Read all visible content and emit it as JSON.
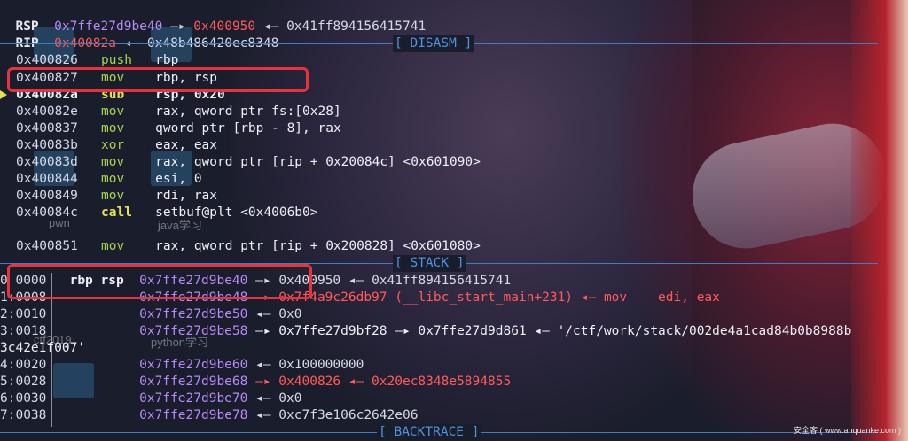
{
  "regs": [
    {
      "name": "RSP",
      "v1": "0x7ffe27d9be40",
      "a1": "—▸",
      "v2": "0x400950",
      "a2": "◂—",
      "v3": "0x41ff894156415741"
    },
    {
      "name": "RIP",
      "v1": "0x40082a",
      "a1": "◂—",
      "v2": "0x48b486420ec8348"
    }
  ],
  "sections": {
    "disasm": "[ DISASM ]",
    "stack": "[ STACK ]",
    "backtrace": "[ BACKTRACE ]"
  },
  "disasm": [
    {
      "addr": "0x400826",
      "op": "push",
      "args": "rbp"
    },
    {
      "addr": "0x400827",
      "op": "mov",
      "args": "rbp, rsp"
    },
    {
      "addr": "0x40082a",
      "op": "sub",
      "args": "rsp, 0x20",
      "current": true
    },
    {
      "addr": "0x40082e",
      "op": "mov",
      "args": "rax, qword ptr fs:[0x28]"
    },
    {
      "addr": "0x400837",
      "op": "mov",
      "args": "qword ptr [rbp - 8], rax"
    },
    {
      "addr": "0x40083b",
      "op": "xor",
      "args": "eax, eax"
    },
    {
      "addr": "0x40083d",
      "op": "mov",
      "args": "rax, qword ptr [rip + 0x20084c] <0x601090>"
    },
    {
      "addr": "0x400844",
      "op": "mov",
      "args": "esi, 0"
    },
    {
      "addr": "0x400849",
      "op": "mov",
      "args": "rdi, rax"
    },
    {
      "addr": "0x40084c",
      "op": "call",
      "args": "setbuf@plt <0x4006b0>"
    },
    {
      "addr": "0x400851",
      "op": "mov",
      "args": "rax, qword ptr [rip + 0x200828] <0x601080>"
    }
  ],
  "stack": [
    {
      "idx": "0",
      "off": "0000",
      "regs": "rbp rsp",
      "addr": "0x7ffe27d9be40",
      "rest": "—▸ 0x400950 ◂— 0x41ff894156415741"
    },
    {
      "idx": "1",
      "off": "0008",
      "regs": "",
      "addr": "0x7ffe27d9be48",
      "rest": "—▸ 0x7f4a9c26db97 (__libc_start_main+231) ◂— mov    edi, eax"
    },
    {
      "idx": "2",
      "off": "0010",
      "regs": "",
      "addr": "0x7ffe27d9be50",
      "rest": "◂— 0x0"
    },
    {
      "idx": "3",
      "off": "0018",
      "regs": "",
      "addr": "0x7ffe27d9be58",
      "rest": "—▸ 0x7ffe27d9bf28 —▸ 0x7ffe27d9d861 ◂— '/ctf/work/stack/002de4a1cad84b0b8988b"
    },
    {
      "idx": "",
      "off": "",
      "regs": "",
      "addr": "",
      "rest": "3c42e1f007'",
      "cont": true
    },
    {
      "idx": "4",
      "off": "0020",
      "regs": "",
      "addr": "0x7ffe27d9be60",
      "rest": "◂— 0x100000000"
    },
    {
      "idx": "5",
      "off": "0028",
      "regs": "",
      "addr": "0x7ffe27d9be68",
      "rest": "—▸ 0x400826 ◂— 0x20ec8348e5894855"
    },
    {
      "idx": "6",
      "off": "0030",
      "regs": "",
      "addr": "0x7ffe27d9be70",
      "rest": "◂— 0x0"
    },
    {
      "idx": "7",
      "off": "0038",
      "regs": "",
      "addr": "0x7ffe27d9be78",
      "rest": "◂— 0xc7f3e106c2642e06"
    }
  ],
  "bg_labels": [
    "pwn",
    "java学习",
    "ctf2019",
    "python学习"
  ],
  "watermark": "安全客 ( www.anquanke.com )"
}
